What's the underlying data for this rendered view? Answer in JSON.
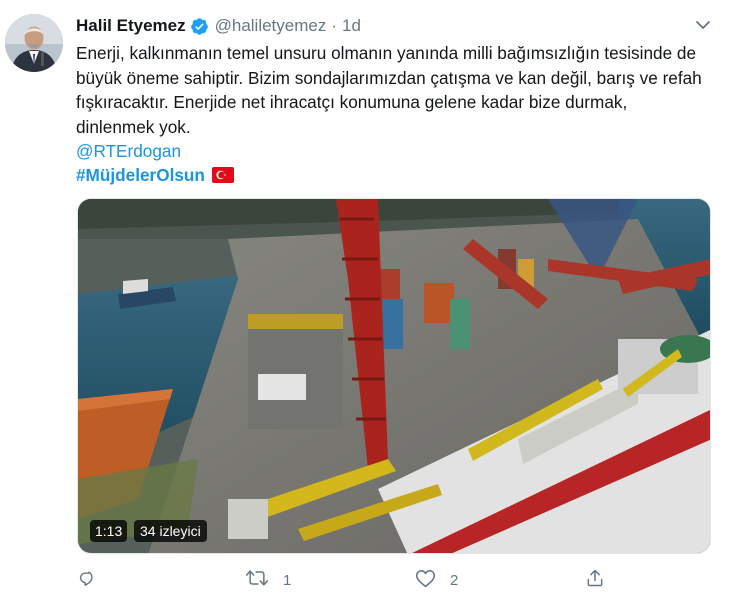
{
  "author": {
    "name": "Halil Etyemez",
    "handle": "@haliletyemez",
    "separator": "·",
    "time": "1d",
    "verified_icon": "verified-badge-icon"
  },
  "tweet": {
    "text": "Enerji, kalkınmanın temel unsuru olmanın yanında milli bağımsızlığın tesisinde de büyük öneme sahiptir. Bizim sondajlarımızdan çatışma ve kan değil, barış ve refah fışkıracaktır. Enerjide net ihracatçı konumuna gelene kadar bize durmak, dinlenmek yok.",
    "mention": "@RTErdogan",
    "hashtag": "#MüjdelerOlsun",
    "hashtag_emoji": "turkey-flag-icon"
  },
  "media": {
    "duration": "1:13",
    "views": "34 izleyici"
  },
  "actions": {
    "reply_count": "",
    "retweet_count": "1",
    "like_count": "2"
  },
  "colors": {
    "link": "#1b95e0",
    "text": "#14171a",
    "secondary": "#657786",
    "verified": "#1da1f2",
    "flag_red": "#e30a17"
  }
}
